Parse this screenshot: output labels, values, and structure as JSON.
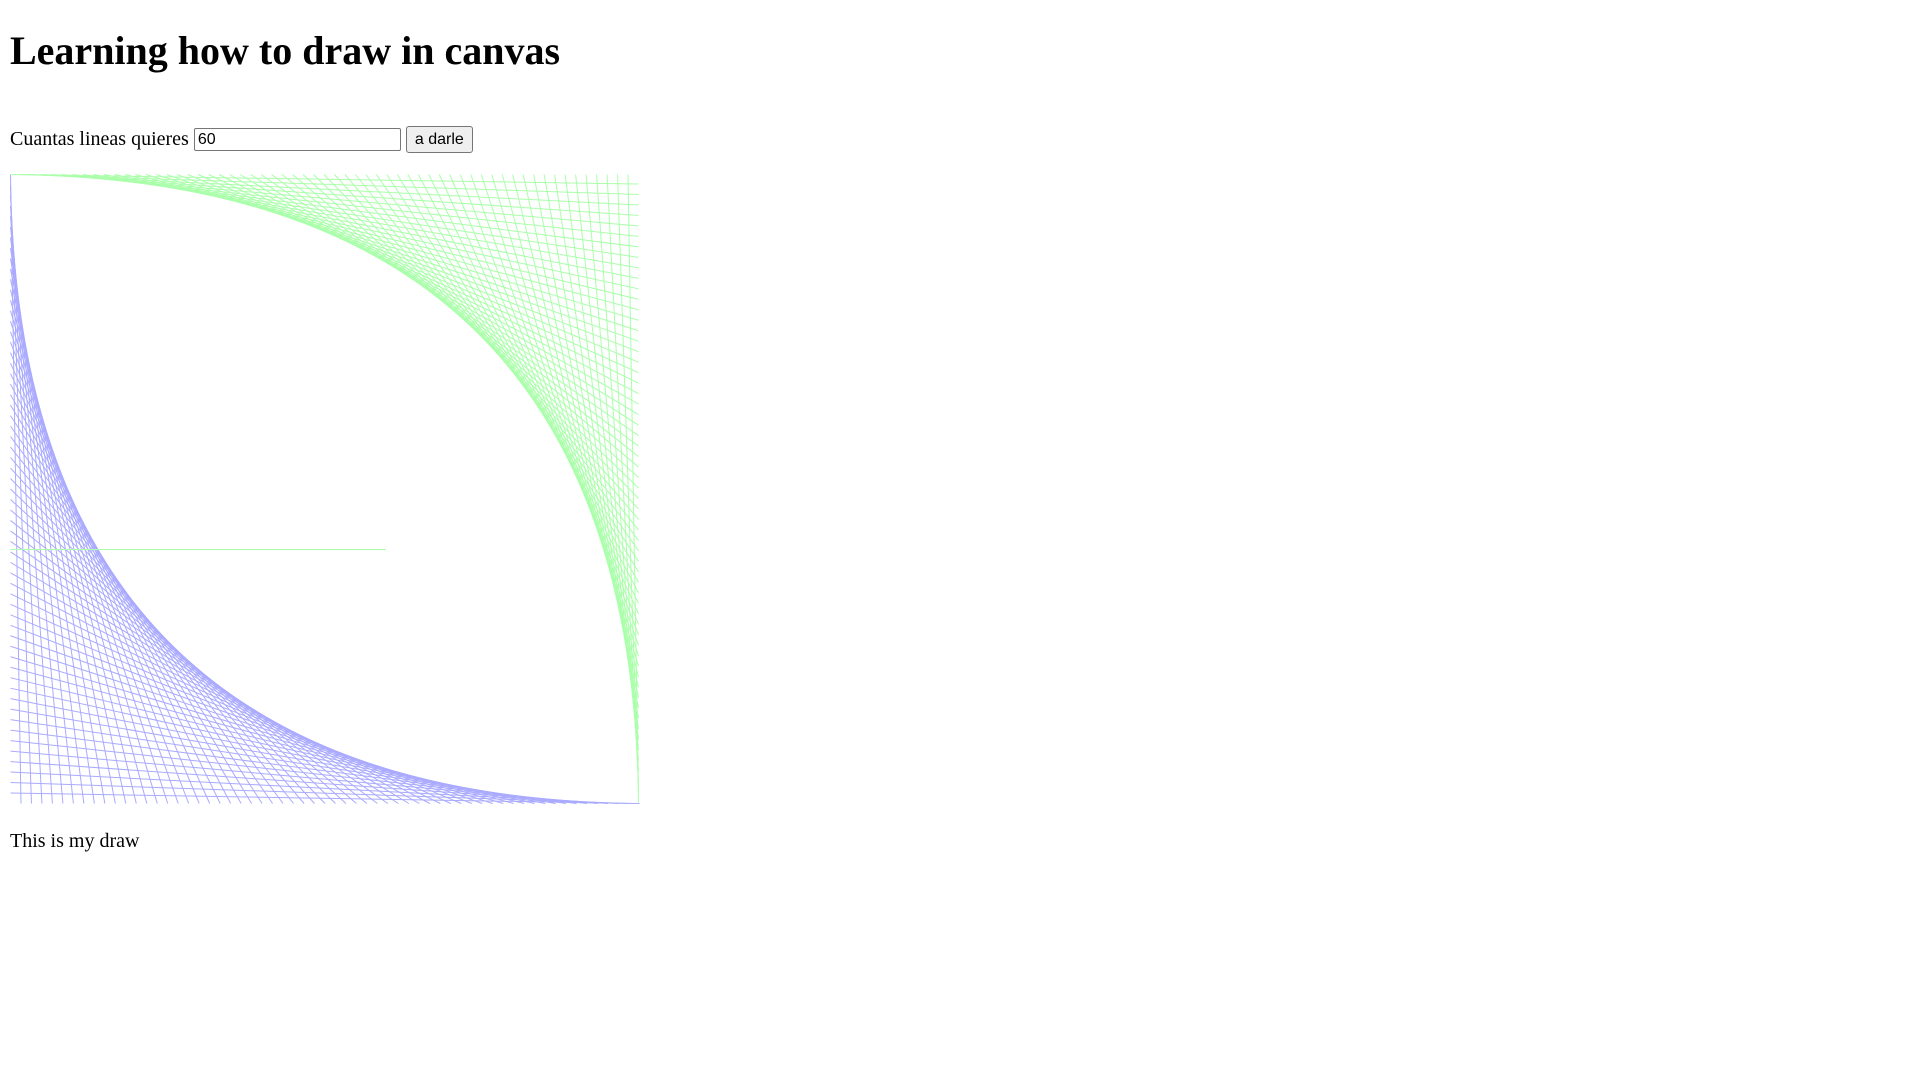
{
  "page": {
    "title": "Learning how to draw in canvas",
    "caption": "This is my draw"
  },
  "controls": {
    "label": "Cuantas lineas quieres",
    "input_value": "60",
    "button_label": "a darle"
  },
  "drawing": {
    "line_count": 60,
    "colors": {
      "bottom_left": "#aaaaff",
      "top_right": "#aaffaa"
    }
  }
}
